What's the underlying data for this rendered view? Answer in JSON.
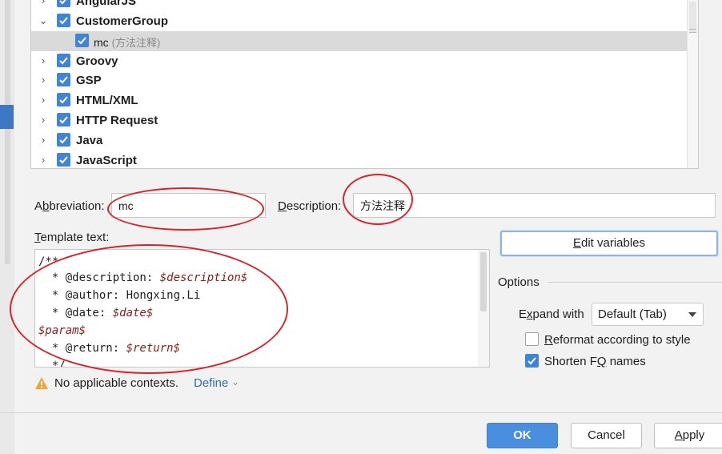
{
  "tree": {
    "items": [
      {
        "label": "AngularJS",
        "expanded": false,
        "checked": true
      },
      {
        "label": "CustomerGroup",
        "expanded": true,
        "checked": true
      },
      {
        "label": "mc",
        "sublabel": "(方法注释)",
        "checked": true,
        "selected": true
      },
      {
        "label": "Groovy",
        "expanded": false,
        "checked": true
      },
      {
        "label": "GSP",
        "expanded": false,
        "checked": true
      },
      {
        "label": "HTML/XML",
        "expanded": false,
        "checked": true
      },
      {
        "label": "HTTP Request",
        "expanded": false,
        "checked": true
      },
      {
        "label": "Java",
        "expanded": false,
        "checked": true
      },
      {
        "label": "JavaScript",
        "expanded": false,
        "checked": true
      }
    ]
  },
  "abbreviation": {
    "label_pre": "A",
    "label_u": "b",
    "label_post": "breviation:",
    "value": "mc"
  },
  "description": {
    "label_u": "D",
    "label_post": "escription:",
    "value": "方法注释"
  },
  "template": {
    "label_u": "T",
    "label_post": "emplate text:",
    "lines": [
      {
        "text": "/**"
      },
      {
        "text": "  * @description: ",
        "var": "$description$"
      },
      {
        "text": "  * @author: Hongxing.Li"
      },
      {
        "text": "  * @date: ",
        "var": "$date$"
      },
      {
        "text": "",
        "var": "$param$"
      },
      {
        "text": "  * @return: ",
        "var": "$return$"
      },
      {
        "text": "  */"
      }
    ]
  },
  "edit_variables": {
    "label_u": "E",
    "label_post": "dit variables"
  },
  "options": {
    "title": "Options",
    "expand_with": {
      "label_pre": "E",
      "label_u": "x",
      "label_post": "pand with",
      "value": "Default (Tab)"
    },
    "reformat": {
      "label_u": "R",
      "label_post": "eformat according to style",
      "checked": false
    },
    "shorten": {
      "label_pre": "Shorten F",
      "label_u": "Q",
      "label_post": " names",
      "checked": true
    }
  },
  "context": {
    "warning": "No applicable contexts.",
    "define_link": "Define"
  },
  "footer": {
    "ok": "OK",
    "cancel": "Cancel",
    "apply_u": "A",
    "apply_post": "pply"
  },
  "colors": {
    "accent": "#3f84d8",
    "ok_button": "#4a8ee0",
    "annotation": "#d4262c",
    "template_variable": "#8b1a1a",
    "link": "#2f6eb5"
  }
}
